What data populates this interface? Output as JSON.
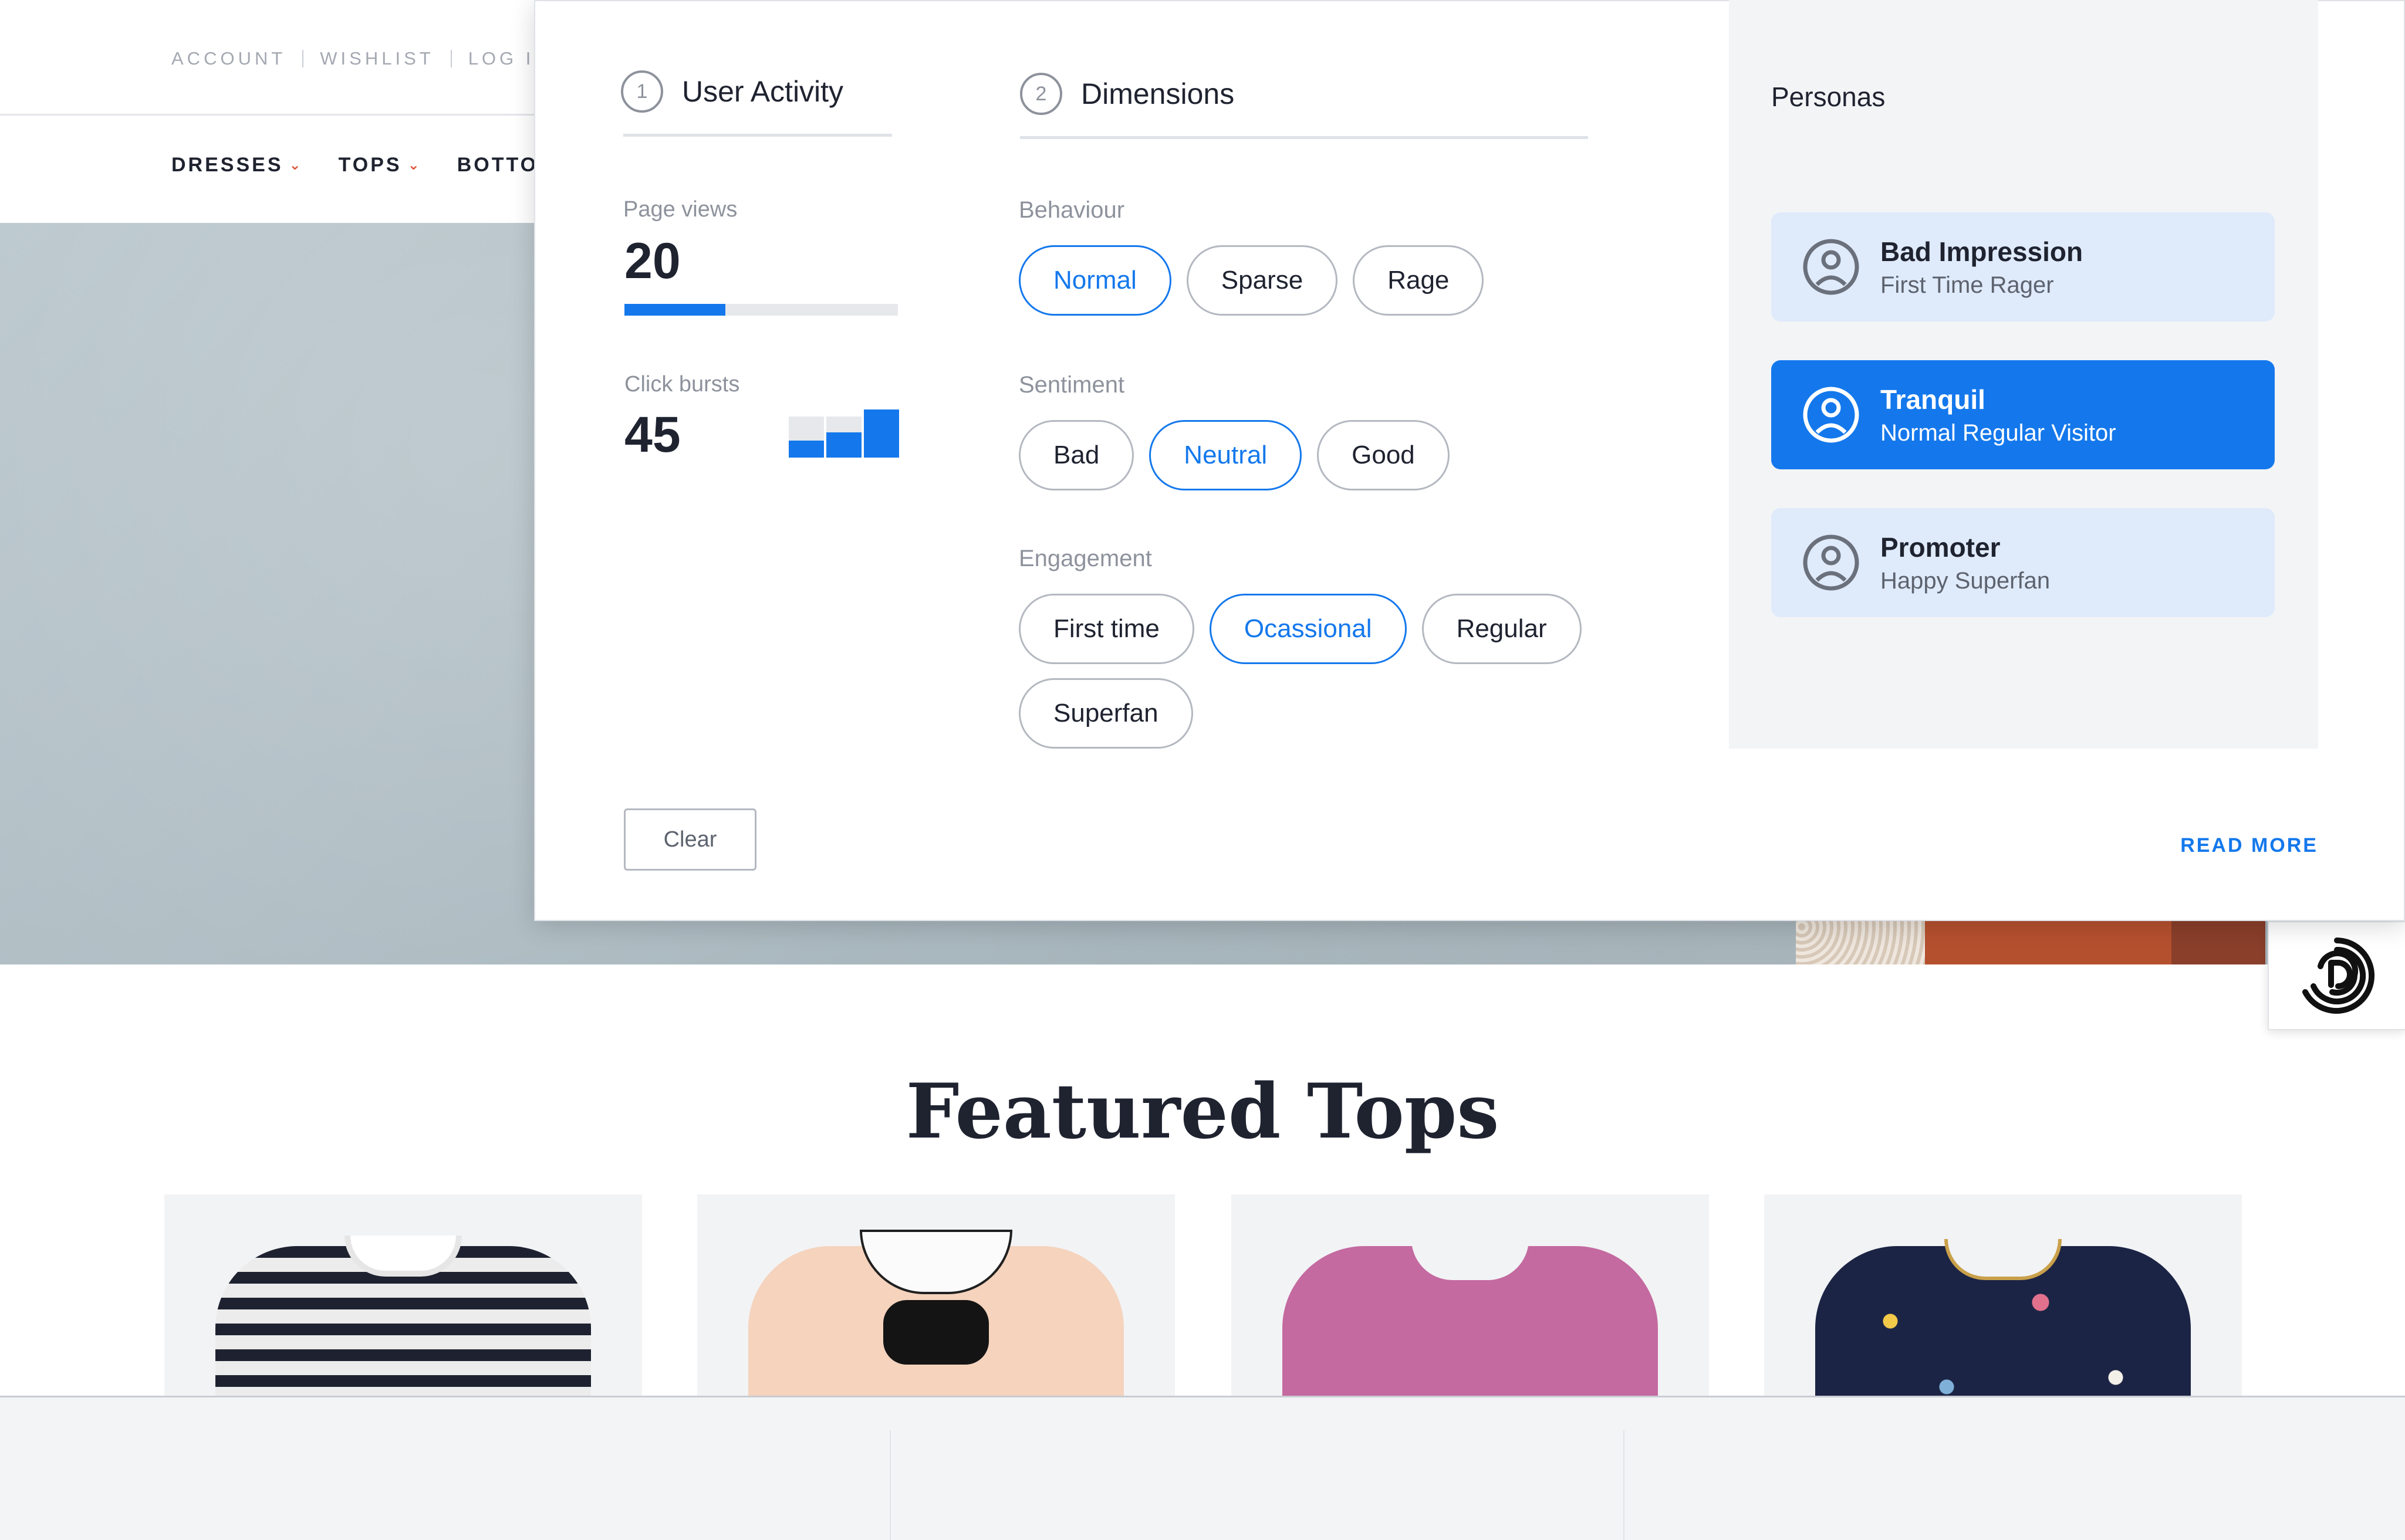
{
  "store": {
    "top_links": [
      "ACCOUNT",
      "WISHLIST",
      "LOG IN"
    ],
    "nav": [
      "DRESSES",
      "TOPS",
      "BOTTOMS"
    ],
    "featured_title": "Featured Tops"
  },
  "panel": {
    "user_activity": {
      "step": "1",
      "title": "User Activity",
      "page_views_label": "Page views",
      "page_views_value": "20",
      "page_views_progress": 0.37,
      "click_bursts_label": "Click bursts",
      "click_bursts_value": "45",
      "click_bursts_levels": [
        0.42,
        0.62,
        1.0
      ]
    },
    "dimensions": {
      "step": "2",
      "title": "Dimensions",
      "groups": [
        {
          "label": "Behaviour",
          "options": [
            "Normal",
            "Sparse",
            "Rage"
          ],
          "selected": "Normal"
        },
        {
          "label": "Sentiment",
          "options": [
            "Bad",
            "Neutral",
            "Good"
          ],
          "selected": "Neutral"
        },
        {
          "label": "Engagement",
          "options": [
            "First time",
            "Ocassional",
            "Regular",
            "Superfan"
          ],
          "selected": "Ocassional"
        }
      ]
    },
    "personas": {
      "title": "Personas",
      "items": [
        {
          "name": "Bad Impression",
          "subtitle": "First Time Rager",
          "active": false,
          "mood": "sad"
        },
        {
          "name": "Tranquil",
          "subtitle": "Normal Regular Visitor",
          "active": true,
          "mood": "sad"
        },
        {
          "name": "Promoter",
          "subtitle": "Happy Superfan",
          "active": false,
          "mood": "sad"
        }
      ]
    },
    "clear_label": "Clear",
    "read_more_label": "READ MORE"
  },
  "colors": {
    "accent": "#1478ec",
    "persona_card": "#dfeafb",
    "panel_side": "#f3f4f6"
  },
  "icons": {
    "persona": "user-circle-icon",
    "widget": "fingerprint-logo-icon",
    "nav_chevron": "chevron-down-icon"
  }
}
